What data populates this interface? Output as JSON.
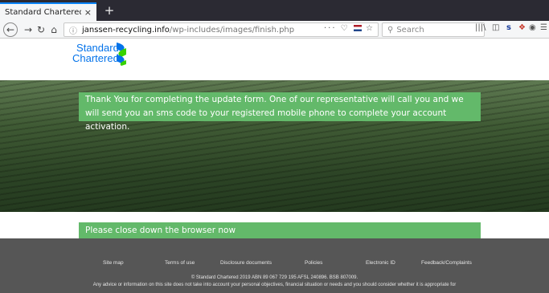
{
  "browser": {
    "tab_title": "Standard Chartered Online",
    "tab_close": "×",
    "new_tab": "+",
    "url_host": "janssen-recycling.info",
    "url_path": "/wp-includes/images/finish.php",
    "url_actions": "··· ♡",
    "search_placeholder": "Search"
  },
  "brand": {
    "name_line1": "Standard",
    "name_line2": "Chartered",
    "colors": {
      "blue": "#0473ea",
      "green": "#38d200"
    }
  },
  "hero": {
    "message": "Thank You for completing the update form. One of our representative will call you and we will send you an sms code to your registered mobile phone to complete your account activation."
  },
  "notice": {
    "close_message": "Please close down the browser now"
  },
  "footer": {
    "links": [
      "Site map",
      "Terms of use",
      "Disclosure documents",
      "Policies",
      "Electronic ID",
      "Feedback/Complaints"
    ],
    "copyright": "© Standard Chartered 2019 ABN 89 067 729 195 AFSL 240896. BSB 807009.",
    "advice": "Any advice or information on this site does not take into account your personal objectives, financial situation or needs and you should consider whether it is appropriate for"
  },
  "colors": {
    "message_bg": "#63b96a",
    "footer_bg": "#565656"
  }
}
